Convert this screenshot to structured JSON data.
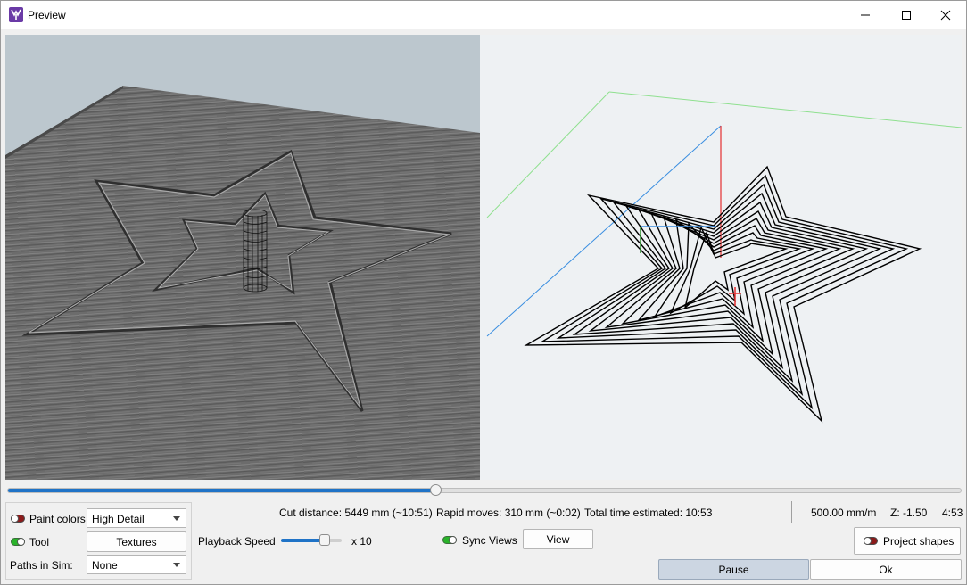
{
  "window": {
    "title": "Preview"
  },
  "stats": {
    "cut_distance": "Cut distance: 5449 mm (~10:51)",
    "rapid_moves": "Rapid moves: 310 mm (~0:02)",
    "total_time": "Total time estimated: 10:53",
    "feed_rate": "500.00 mm/m",
    "z_position": "Z: -1.50",
    "elapsed": "4:53"
  },
  "progress": {
    "fraction": 0.449
  },
  "options": {
    "paint_colors_label": "Paint colors",
    "paint_colors_enabled": false,
    "detail_value": "High Detail",
    "tool_label": "Tool",
    "tool_enabled": true,
    "textures_label": "Textures",
    "paths_label": "Paths in Sim:",
    "paths_value": "None"
  },
  "playback": {
    "label": "Playback Speed",
    "multiplier": "x 10",
    "fraction": 0.72
  },
  "sync": {
    "label": "Sync Views",
    "enabled": true,
    "view_button": "View"
  },
  "project_shapes": {
    "label": "Project shapes",
    "enabled": false
  },
  "buttons": {
    "pause": "Pause",
    "ok": "Ok"
  },
  "colors": {
    "accent": "#1f73c7",
    "toggle_on": "#29b32a",
    "toggle_off": "#8b1a1a",
    "x_axis": "#e53030",
    "y_axis": "#2a8f2a",
    "z_axis": "#3a8ee0"
  }
}
